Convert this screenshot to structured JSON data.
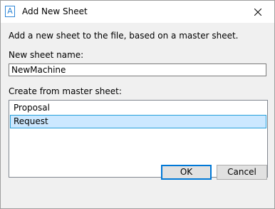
{
  "window": {
    "title": "Add New Sheet",
    "app_icon_glyph": "A",
    "app_icon_name": "app-icon",
    "accent_color": "#0078d7",
    "selection_color": "#cce8ff"
  },
  "dialog": {
    "description": "Add a new sheet to the file, based on a master sheet.",
    "name_label": "New sheet name:",
    "name_value": "NewMachine",
    "master_label": "Create from master sheet:",
    "master_sheets": [
      {
        "label": "Proposal",
        "selected": false
      },
      {
        "label": "Request",
        "selected": true
      }
    ],
    "selected_master": "Request"
  },
  "buttons": {
    "ok_label": "OK",
    "cancel_label": "Cancel"
  }
}
